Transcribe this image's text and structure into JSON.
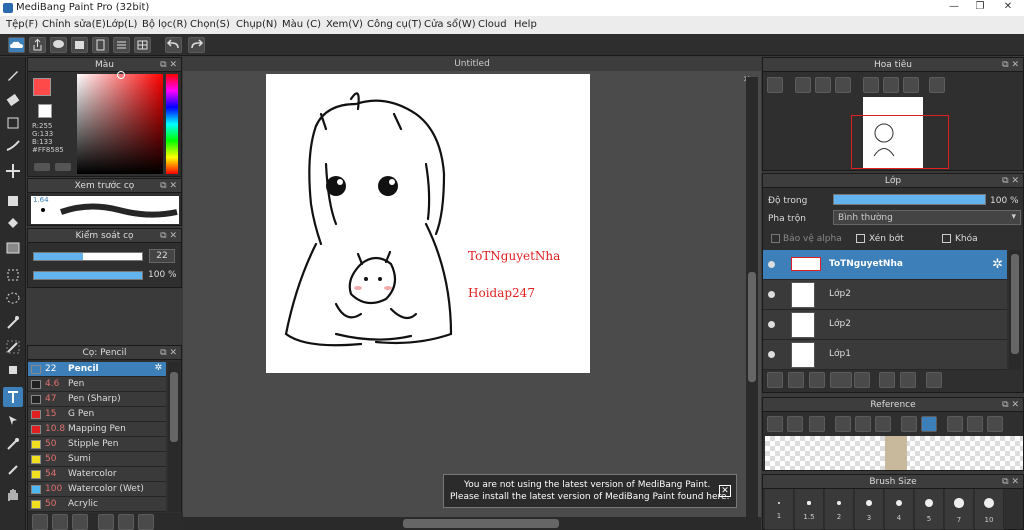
{
  "window": {
    "title": "MediBang Paint Pro (32bit)",
    "min_label": "—",
    "restore_label": "❐",
    "close_label": "✕"
  },
  "menu": [
    "Tệp(F)",
    "Chỉnh sửa(E)",
    "Lớp(L)",
    "Bộ lọc(R)",
    "Chọn(S)",
    "Chụp(N)",
    "Màu (C)",
    "Xem(V)",
    "Công cụ(T)",
    "Cửa sổ(W)",
    "Cloud",
    "Help"
  ],
  "canvas": {
    "tab_title": "Untitled",
    "text1": "ToTNguyetNha",
    "text2": "Hoidap247",
    "text_color": "#e02020"
  },
  "color_panel": {
    "title": "Màu",
    "r": "R:255",
    "g": "G:133",
    "b": "B:133",
    "hex": "#FF8585",
    "fg": "#ff4a4a"
  },
  "preview_panel": {
    "title": "Xem trước cọ",
    "size": "1.64"
  },
  "control_panel": {
    "title": "Kiểm soát cọ",
    "size_value": "22",
    "opacity_value": "100 %",
    "size_fill": 0.45,
    "opacity_fill": 1.0
  },
  "brush_panel": {
    "title": "Cọ: Pencil",
    "items": [
      {
        "size": "22",
        "name": "Pencil",
        "color": "#3d7fb8",
        "selected": true
      },
      {
        "size": "4.6",
        "name": "Pen",
        "color": "#222222"
      },
      {
        "size": "47",
        "name": "Pen (Sharp)",
        "color": "#222222"
      },
      {
        "size": "15",
        "name": "G Pen",
        "color": "#e02020"
      },
      {
        "size": "10.8",
        "name": "Mapping Pen",
        "color": "#e02020"
      },
      {
        "size": "50",
        "name": "Stipple Pen",
        "color": "#f0e020"
      },
      {
        "size": "50",
        "name": "Sumi",
        "color": "#f0e020"
      },
      {
        "size": "54",
        "name": "Watercolor",
        "color": "#f0e020"
      },
      {
        "size": "100",
        "name": "Watercolor (Wet)",
        "color": "#4fb8f0"
      },
      {
        "size": "50",
        "name": "Acrylic",
        "color": "#f0e020"
      }
    ]
  },
  "navigator_panel": {
    "title": "Hoa tiêu"
  },
  "layer_panel": {
    "title": "Lớp",
    "opacity_label": "Độ trong",
    "opacity_value": "100 %",
    "blend_label": "Pha trộn",
    "blend_value": "Bình thường",
    "protect_alpha": "Bảo vệ alpha",
    "clipping": "Xén bớt",
    "lock": "Khóa",
    "layers": [
      {
        "name": "ToTNguyetNha",
        "selected": true
      },
      {
        "name": "Lớp2"
      },
      {
        "name": "Lớp2"
      },
      {
        "name": "Lớp1"
      }
    ]
  },
  "reference_panel": {
    "title": "Reference"
  },
  "brush_size_panel": {
    "title": "Brush Size",
    "sizes": [
      "1",
      "1.5",
      "2",
      "3",
      "4",
      "5",
      "7",
      "10"
    ]
  },
  "notification": {
    "line1": "You are not using the latest version of MediBang Paint.",
    "line2": "Please install the latest version of MediBang Paint found here."
  },
  "icons": [
    "cloud-icon",
    "share-icon",
    "comment-icon",
    "layers-icon",
    "page-icon",
    "menu-icon",
    "grid-icon",
    "undo-icon",
    "redo-icon",
    "brush-icon",
    "eraser-icon",
    "select-rect-icon",
    "pen-icon",
    "move-icon",
    "fill-icon",
    "bucket-icon",
    "gradient-icon",
    "lasso-icon",
    "magic-wand-icon",
    "text-icon",
    "eyedropper-icon",
    "hand-icon"
  ]
}
